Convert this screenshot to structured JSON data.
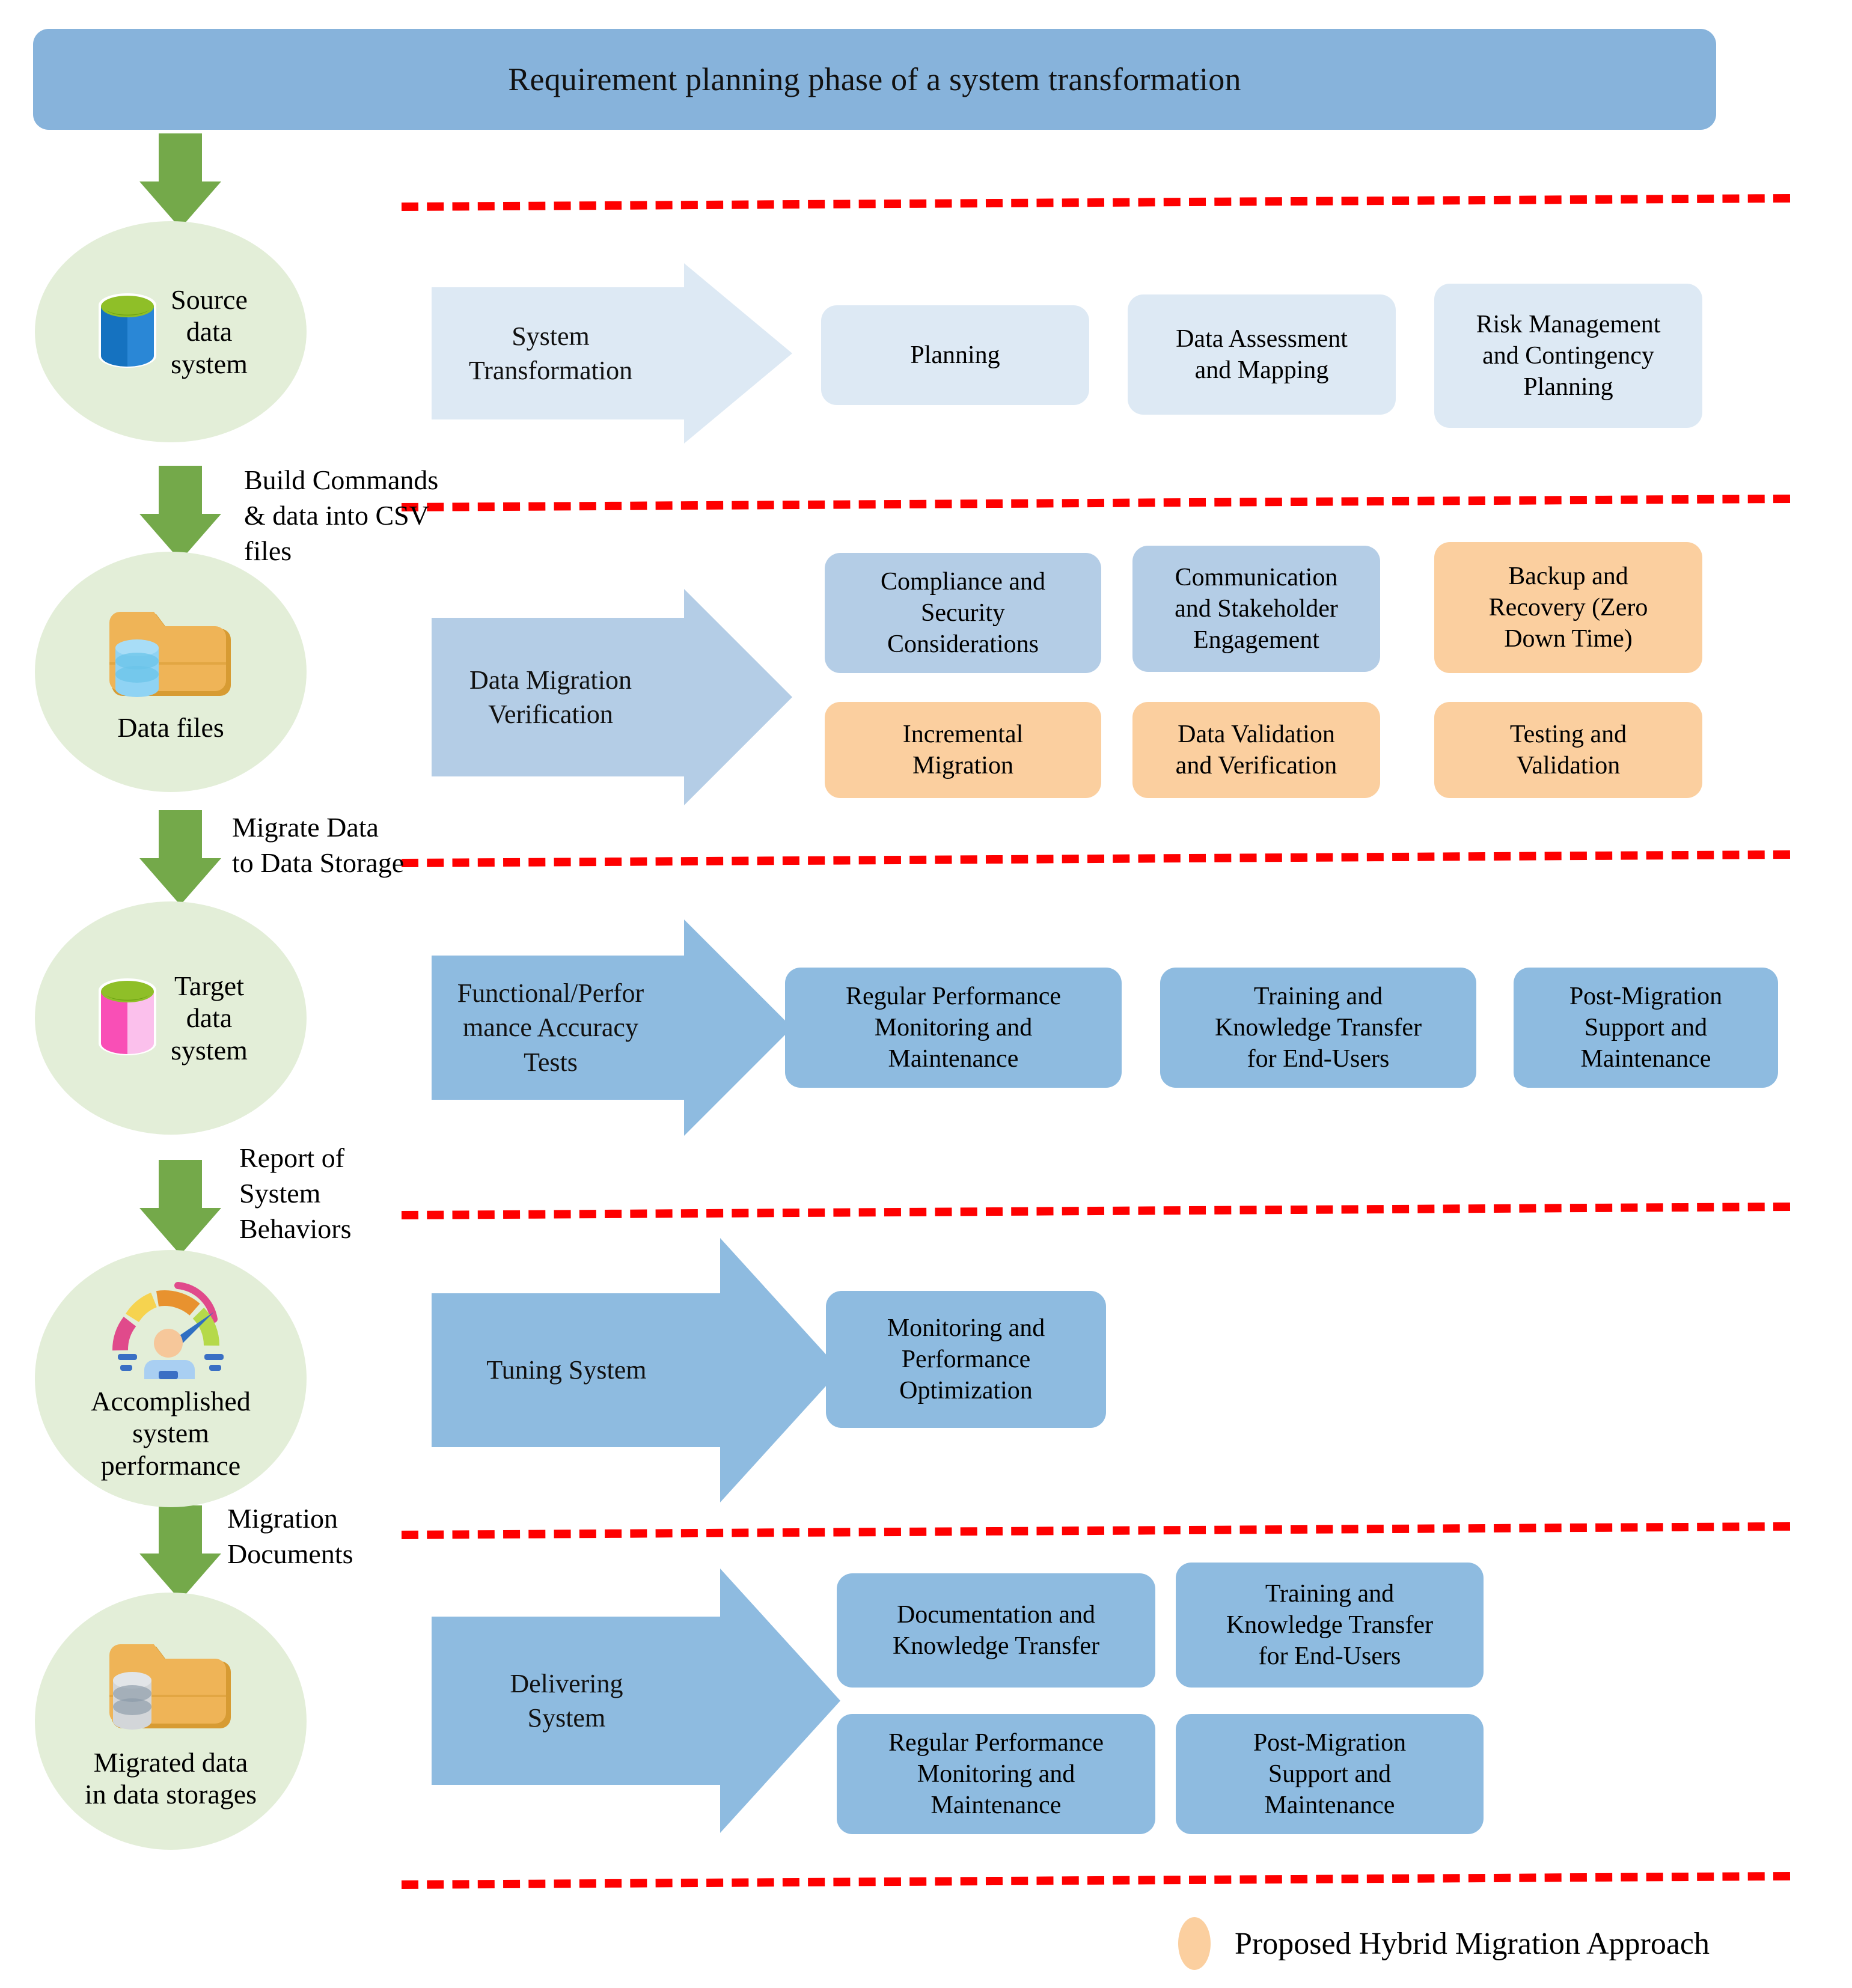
{
  "title": "Requirement planning phase of a system transformation",
  "legend": {
    "swatch_color": "#fbcf9f",
    "label": "Proposed Hybrid Migration Approach"
  },
  "colors": {
    "banner": "#87b3db",
    "node_ellipse": "#e3eed8",
    "green_arrow": "#74a94a",
    "separator": "#fe0000",
    "card_pale_blue": "#dde9f4",
    "card_mid_blue": "#b4cde6",
    "card_blue": "#8ebbe0",
    "card_orange": "#fbcf9f"
  },
  "nodes": [
    {
      "id": "source-data-system",
      "label": "Source\ndata\nsystem",
      "icon": "database-cylinder-blue"
    },
    {
      "id": "data-files",
      "label": "Data files",
      "icon": "folder-with-database-blue"
    },
    {
      "id": "target-data-system",
      "label": "Target\ndata\nsystem",
      "icon": "database-cylinder-pink"
    },
    {
      "id": "accomplished-system-performance",
      "label": "Accomplished\nsystem\nperformance",
      "icon": "performance-gauge"
    },
    {
      "id": "migrated-data",
      "label": "Migrated data\nin data storages",
      "icon": "folder-with-database-grey"
    }
  ],
  "edge_labels": [
    {
      "id": "build-commands",
      "text": "Build Commands\n& data into CSV\nfiles"
    },
    {
      "id": "migrate-data",
      "text": "Migrate Data\nto Data Storage"
    },
    {
      "id": "report-of-system-behaviors",
      "text": "Report of\nSystem\nBehaviors"
    },
    {
      "id": "migration-documents",
      "text": "Migration\nDocuments"
    }
  ],
  "phases": [
    {
      "id": "system-transformation",
      "arrow_label": "System\nTransformation",
      "arrow_color": "#dde9f4",
      "cards": [
        {
          "label": "Planning",
          "color": "pale"
        },
        {
          "label": "Data Assessment\nand Mapping",
          "color": "pale"
        },
        {
          "label": "Risk Management\nand Contingency\nPlanning",
          "color": "pale"
        }
      ]
    },
    {
      "id": "data-migration-verification",
      "arrow_label": "Data Migration\nVerification",
      "arrow_color": "#b4cde6",
      "cards": [
        {
          "label": "Compliance and\nSecurity\nConsiderations",
          "color": "mid"
        },
        {
          "label": "Communication\nand Stakeholder\nEngagement",
          "color": "mid"
        },
        {
          "label": "Backup and\nRecovery (Zero\nDown Time)",
          "color": "orange"
        },
        {
          "label": "Incremental\nMigration",
          "color": "orange"
        },
        {
          "label": "Data Validation\nand Verification",
          "color": "orange"
        },
        {
          "label": "Testing and\nValidation",
          "color": "orange"
        }
      ]
    },
    {
      "id": "functional-performance-accuracy-tests",
      "arrow_label": "Functional/Perfor\nmance Accuracy\nTests",
      "arrow_color": "#8ebbe0",
      "cards": [
        {
          "label": "Regular Performance\nMonitoring and\nMaintenance",
          "color": "blue"
        },
        {
          "label": "Training and\nKnowledge Transfer\nfor End-Users",
          "color": "blue"
        },
        {
          "label": "Post-Migration\nSupport and\nMaintenance",
          "color": "blue"
        }
      ]
    },
    {
      "id": "tuning-system",
      "arrow_label": "Tuning System",
      "arrow_color": "#8ebbe0",
      "cards": [
        {
          "label": "Monitoring and\nPerformance\nOptimization",
          "color": "blue"
        }
      ]
    },
    {
      "id": "delivering-system",
      "arrow_label": "Delivering\nSystem",
      "arrow_color": "#8ebbe0",
      "cards": [
        {
          "label": "Documentation and\nKnowledge Transfer",
          "color": "blue"
        },
        {
          "label": "Training and\nKnowledge Transfer\nfor End-Users",
          "color": "blue"
        },
        {
          "label": "Regular Performance\nMonitoring and\nMaintenance",
          "color": "blue"
        },
        {
          "label": "Post-Migration\nSupport and\nMaintenance",
          "color": "blue"
        }
      ]
    }
  ]
}
